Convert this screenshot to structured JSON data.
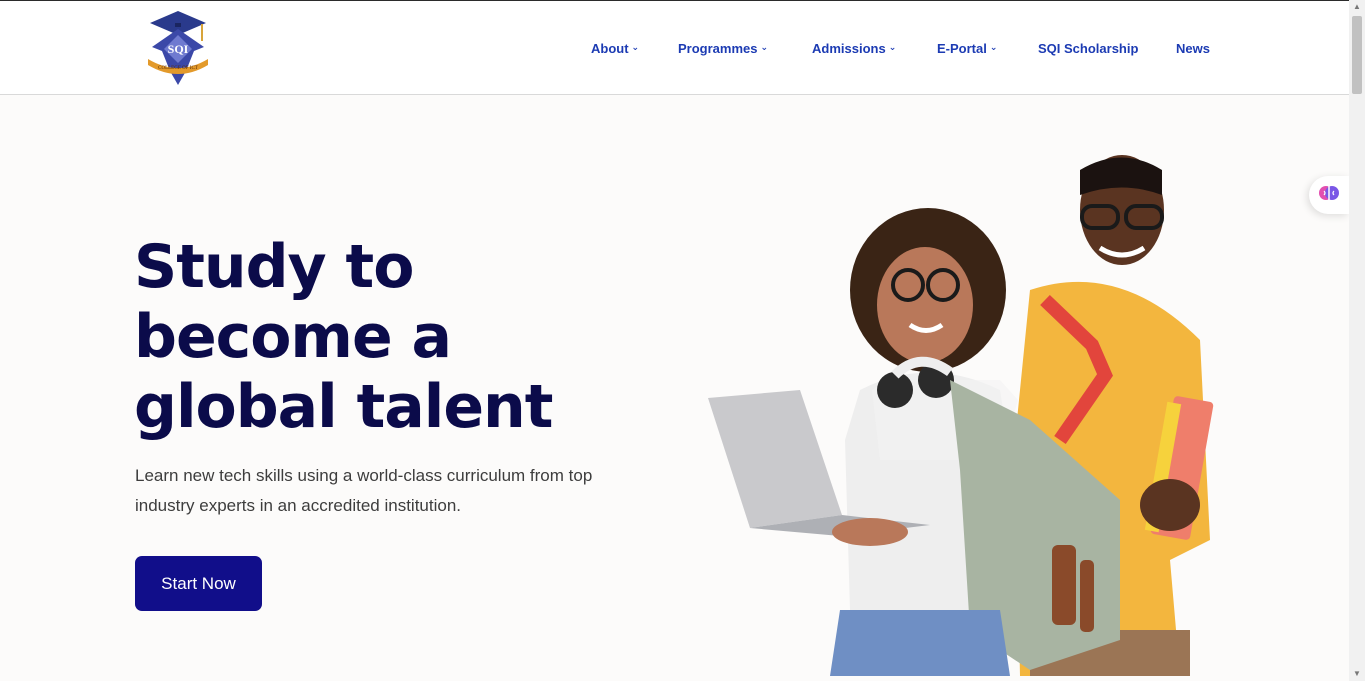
{
  "header": {
    "logo_text": "SQI",
    "logo_banner": "COLLEGE OF ICT"
  },
  "nav": {
    "items": [
      {
        "label": "About",
        "dropdown": true
      },
      {
        "label": "Programmes",
        "dropdown": true
      },
      {
        "label": "Admissions",
        "dropdown": true
      },
      {
        "label": "E-Portal",
        "dropdown": true
      },
      {
        "label": "SQI Scholarship",
        "dropdown": false
      },
      {
        "label": "News",
        "dropdown": false
      }
    ],
    "chevron": "⌄"
  },
  "hero": {
    "title_lines": [
      "Study to",
      "become a",
      "global talent"
    ],
    "subtitle_lines": [
      "Learn new tech skills using a world-class curriculum from top",
      "industry experts in an accredited institution."
    ],
    "cta_label": "Start Now"
  },
  "colors": {
    "nav": "#1c3bb3",
    "title": "#0b0b4a",
    "cta": "#110e8a",
    "background": "#fcfbfa"
  },
  "icons": {
    "widget": "brain-icon"
  }
}
